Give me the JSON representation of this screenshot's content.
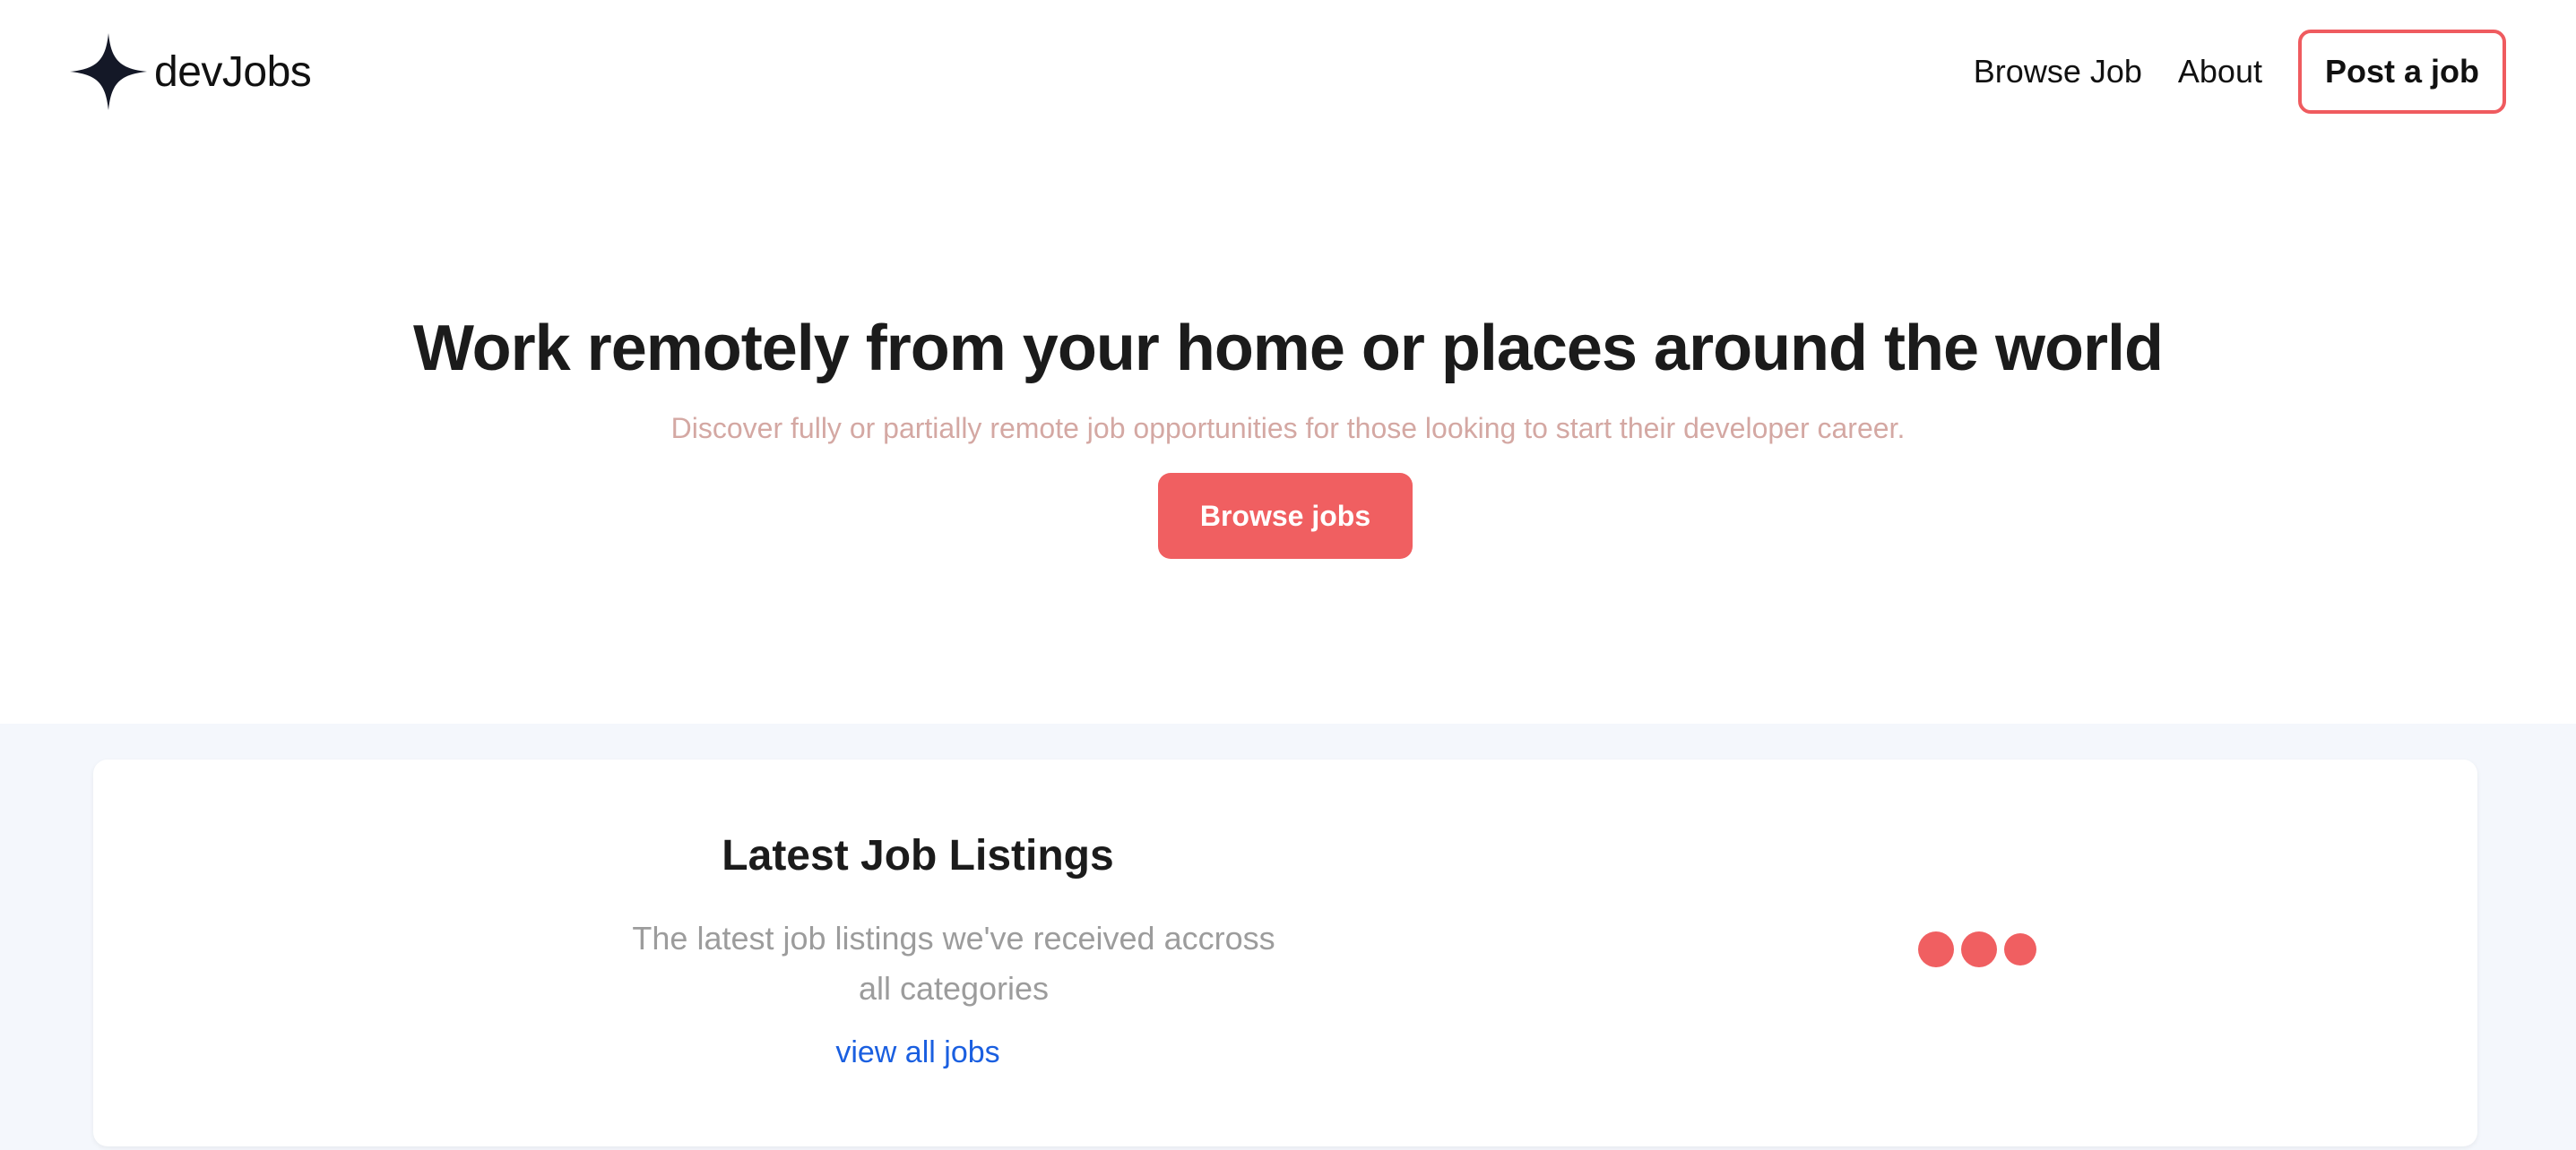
{
  "brand": {
    "name": "devJobs",
    "icon": "four-point-star-icon"
  },
  "nav": {
    "browse_job": "Browse Job",
    "about": "About",
    "post_job": "Post a job"
  },
  "hero": {
    "title": "Work remotely from your home or places around the world",
    "subtitle": "Discover fully or partially remote job opportunities for those looking to start their developer career.",
    "cta": "Browse jobs"
  },
  "listings": {
    "title": "Latest Job Listings",
    "description": "The latest job listings we've received accross all categories",
    "view_all": "view all jobs",
    "loading_indicator": "three-dot-loader-icon"
  },
  "colors": {
    "accent": "#f05f61",
    "link": "#1a5fe0",
    "subtitle": "#d4a8a3",
    "section_bg": "#f4f7fc"
  }
}
